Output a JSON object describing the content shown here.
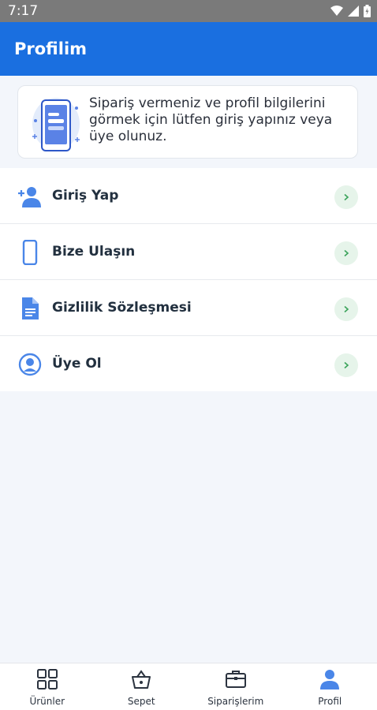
{
  "status_bar": {
    "time": "7:17"
  },
  "app_bar": {
    "title": "Profilim"
  },
  "info_card": {
    "message": "Sipariş vermeniz ve profil bilgilerini görmek için lütfen giriş yapınız veya üye olunuz."
  },
  "menu": {
    "items": [
      {
        "label": "Giriş Yap",
        "icon": "add-user-icon"
      },
      {
        "label": "Bize Ulaşın",
        "icon": "phone-icon"
      },
      {
        "label": "Gizlilik Sözleşmesi",
        "icon": "document-icon"
      },
      {
        "label": "Üye Ol",
        "icon": "account-circle-icon"
      }
    ]
  },
  "bottom_nav": {
    "items": [
      {
        "label": "Ürünler",
        "icon": "grid-icon",
        "active": false
      },
      {
        "label": "Sepet",
        "icon": "basket-icon",
        "active": false
      },
      {
        "label": "Siparişlerim",
        "icon": "orders-box-icon",
        "active": false
      },
      {
        "label": "Profil",
        "icon": "person-icon",
        "active": true
      }
    ]
  },
  "colors": {
    "primary": "#1a6fe0",
    "accent_icon": "#4a86e8",
    "chevron_bg": "#e6f4ea",
    "chevron_fg": "#3aa35a"
  }
}
